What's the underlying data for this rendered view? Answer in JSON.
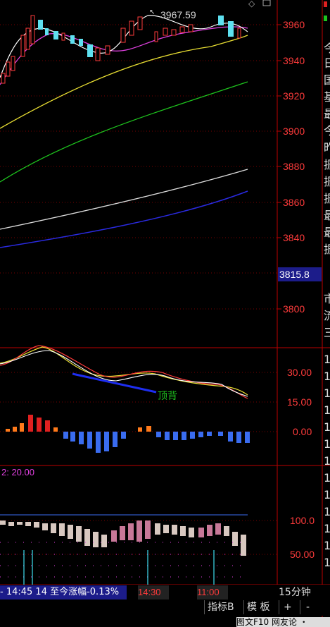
{
  "main_chart": {
    "price_label": "3967.59",
    "y_ticks": [
      "3960",
      "3940",
      "3920",
      "3900",
      "3880",
      "3860",
      "3840",
      "3800"
    ],
    "current_price": "3815.8"
  },
  "macd": {
    "y_ticks": [
      "30.00",
      "15.00",
      "0.00"
    ],
    "signal_text": "顶背"
  },
  "kd": {
    "header": "2: 20.00",
    "y_ticks": [
      "100.0",
      "50.00"
    ]
  },
  "time_bar": {
    "info": "- 14:45 14 至今涨幅-0.13%",
    "t1": "14:30",
    "t2": "11:00",
    "period": "15分钟"
  },
  "toolbar": {
    "indicator_label": "指标B",
    "template_label": "模 板",
    "plus_label": "+",
    "minus_label": "-"
  },
  "status_bar": {
    "text": "图文F10 网友论 ・"
  },
  "right_panel_chars": [
    "今",
    "日",
    "国",
    "基",
    "最",
    "今",
    "昨",
    "振",
    "振",
    "振",
    "最",
    "最",
    "振",
    "市",
    "流",
    "三"
  ],
  "right_panel_digits": [
    "1",
    "1",
    "1",
    "1",
    "1",
    "1",
    "1",
    "1",
    "1",
    "1",
    "1",
    "1",
    "1"
  ]
}
